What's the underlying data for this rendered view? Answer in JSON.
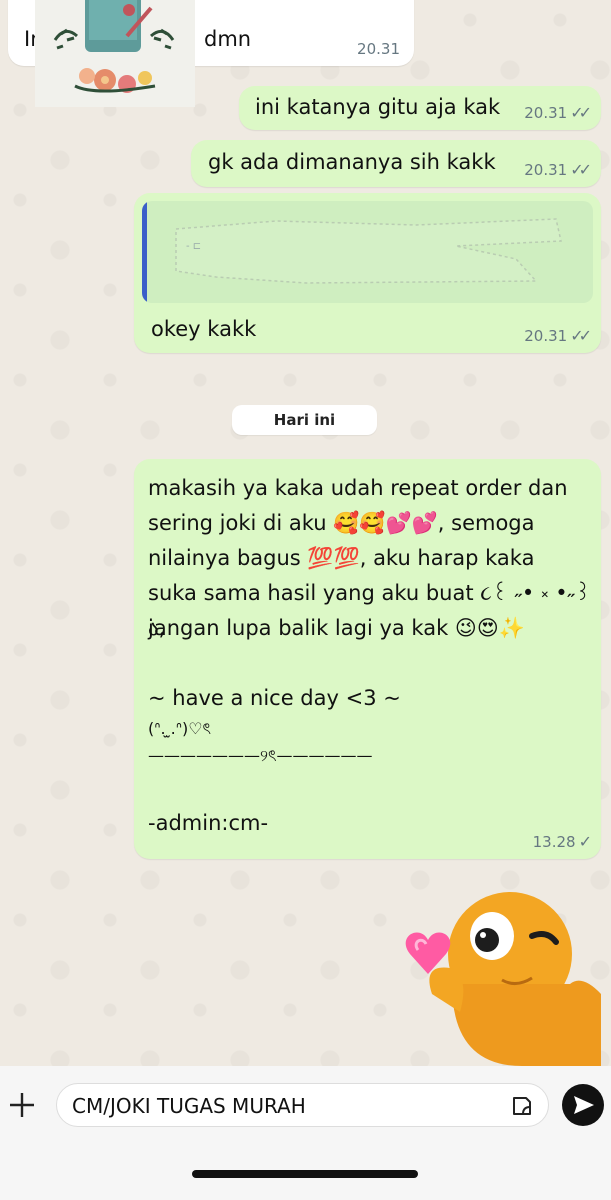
{
  "messages": {
    "m0_text": "In",
    "m0_text_tail": "dmn",
    "m0_time": "20.31",
    "m1_text": "ini katanya gitu aja kak",
    "m1_time": "20.31",
    "m2_text": "gk ada dimananya sih kakk",
    "m2_time": "20.31",
    "m3_text": "okey kakk",
    "m3_time": "20.31",
    "m4_lines": [
      "makasih ya kaka udah repeat order dan",
      "sering joki di aku 🥰🥰💕💕, semoga",
      "nilainya bagus 💯💯, aku harap kaka",
      "suka sama hasil yang aku buat ૮꒰ ˶• ༝ •˶꒱ა,",
      "jangan lupa balik lagi ya kak 😉😍✨",
      "",
      "~ have a nice day <3 ~",
      "(ᐢ. ̫.ᐢ)♡ৎ",
      "———————୨ৎ——————",
      "",
      "-admin:cm-"
    ],
    "m4_time": "13.28"
  },
  "date_separator": "Hari ini",
  "composer": {
    "value": "CM/JOKI TUGAS MURAH"
  },
  "icons": {
    "plus": "plus-icon",
    "sticker": "sticker-icon",
    "send": "send-icon",
    "read_receipt": "double-check-icon",
    "sent_receipt": "single-check-icon"
  },
  "colors": {
    "chat_background": "#efeae2",
    "outgoing_bubble": "#dcf8c6",
    "incoming_bubble": "#ffffff",
    "quote_bar": "#3b5fc9"
  }
}
